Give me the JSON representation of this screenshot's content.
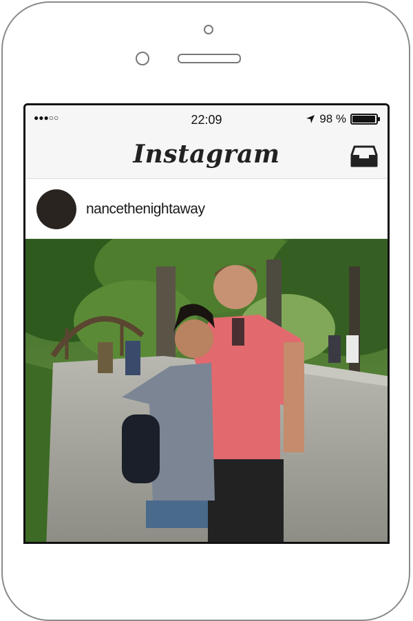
{
  "status_bar": {
    "signal": "●●●○○",
    "time": "22:09",
    "battery_percent": "98 %",
    "battery_level": 0.98
  },
  "header": {
    "title": "Instagram",
    "inbox_icon": "inbox-icon"
  },
  "post": {
    "username": "nancethenightaway",
    "avatar_color": "#2a2420"
  },
  "colors": {
    "bar_bg": "#f6f6f6",
    "phone_outline": "#8a8a8a"
  }
}
